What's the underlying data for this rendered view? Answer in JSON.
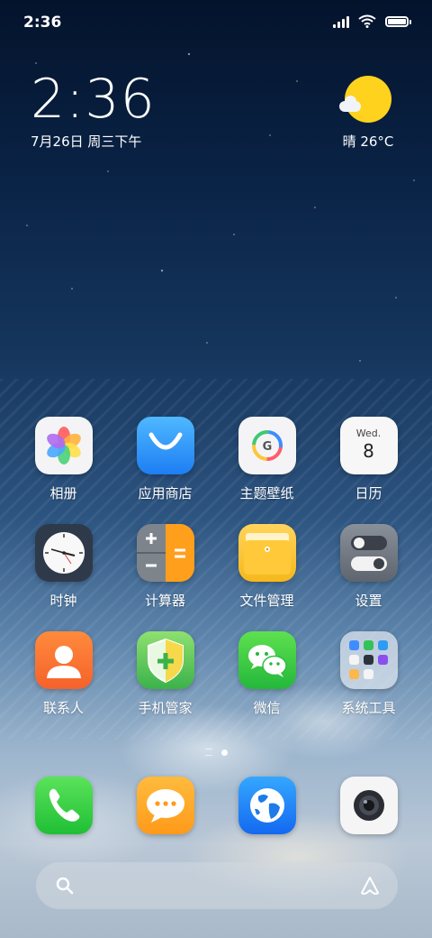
{
  "status_bar": {
    "time": "2:36"
  },
  "clock_widget": {
    "time": "2:36",
    "date": "7月26日 周三下午"
  },
  "weather_widget": {
    "text": "晴 26°C",
    "icon": "sunny-partly-cloudy-icon"
  },
  "apps": [
    {
      "label": "相册",
      "icon": "photos-icon"
    },
    {
      "label": "应用商店",
      "icon": "app-store-icon"
    },
    {
      "label": "主题壁纸",
      "icon": "themes-icon"
    },
    {
      "label": "日历",
      "icon": "calendar-icon",
      "weekday": "Wed.",
      "day": "8"
    },
    {
      "label": "时钟",
      "icon": "clock-icon"
    },
    {
      "label": "计算器",
      "icon": "calculator-icon"
    },
    {
      "label": "文件管理",
      "icon": "file-manager-icon"
    },
    {
      "label": "设置",
      "icon": "settings-icon"
    },
    {
      "label": "联系人",
      "icon": "contacts-icon"
    },
    {
      "label": "手机管家",
      "icon": "security-icon"
    },
    {
      "label": "微信",
      "icon": "wechat-icon"
    },
    {
      "label": "系统工具",
      "icon": "folder-icon"
    }
  ],
  "dock": [
    {
      "icon": "phone-icon"
    },
    {
      "icon": "messages-icon"
    },
    {
      "icon": "browser-icon"
    },
    {
      "icon": "camera-icon"
    }
  ],
  "page_indicator": {
    "pages": 2,
    "active": 1
  },
  "colors": {
    "accent_yellow": "#ffd21e",
    "wechat_green": "#24b83b",
    "store_blue": "#1d7ef3"
  }
}
